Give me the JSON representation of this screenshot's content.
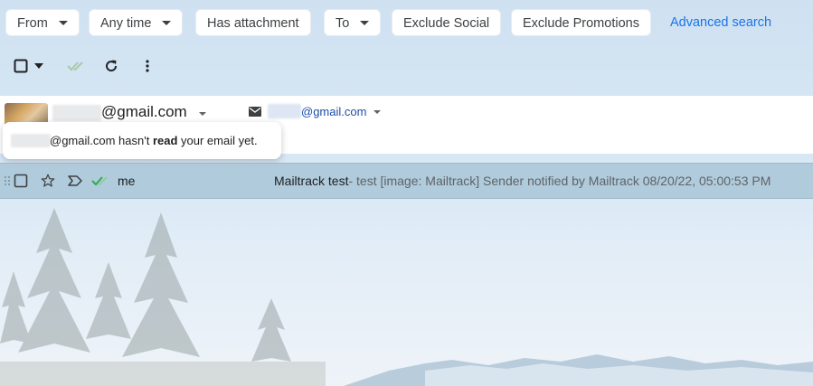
{
  "filters": {
    "chips": [
      {
        "label": "From",
        "dropdown": true
      },
      {
        "label": "Any time",
        "dropdown": true
      },
      {
        "label": "Has attachment",
        "dropdown": false
      },
      {
        "label": "To",
        "dropdown": true
      },
      {
        "label": "Exclude Social",
        "dropdown": false
      },
      {
        "label": "Exclude Promotions",
        "dropdown": false
      }
    ],
    "advanced_search": "Advanced search"
  },
  "toolbar": {
    "icons": [
      "select-checkbox-icon",
      "select-dropdown-icon",
      "mailtrack-double-check-icon",
      "refresh-icon",
      "more-vert-icon"
    ]
  },
  "account": {
    "email_suffix": "@gmail.com",
    "recipient_suffix": "@gmail.com"
  },
  "tooltip": {
    "prefix": "@gmail.com hasn't ",
    "bold": "read",
    "suffix": " your email yet."
  },
  "email": {
    "sender": "me",
    "subject": "Mailtrack test",
    "snippet": " - test [image: Mailtrack] Sender notified by Mailtrack 08/20/22, 05:00:53 PM"
  },
  "colors": {
    "accent": "#1a73e8",
    "mailtrack_check": "#34a853",
    "row_highlight": "#acc8d8"
  }
}
